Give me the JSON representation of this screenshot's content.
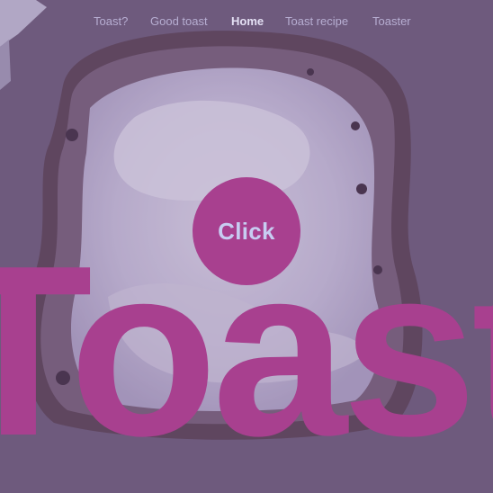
{
  "nav": {
    "items": [
      {
        "label": "Toast?",
        "active": false
      },
      {
        "label": "Good toast",
        "active": false
      },
      {
        "label": "Home",
        "active": true
      },
      {
        "label": "Toast recipe",
        "active": false
      },
      {
        "label": "Toaster",
        "active": false
      }
    ]
  },
  "cta": {
    "label": "Click"
  },
  "hero": {
    "word": "Toast"
  },
  "colors": {
    "background": "#6f5e78",
    "accent": "#a8408f",
    "nav_text": "#b7aed2",
    "nav_active": "#e4e0f4",
    "button_text": "#c7cdf2"
  }
}
